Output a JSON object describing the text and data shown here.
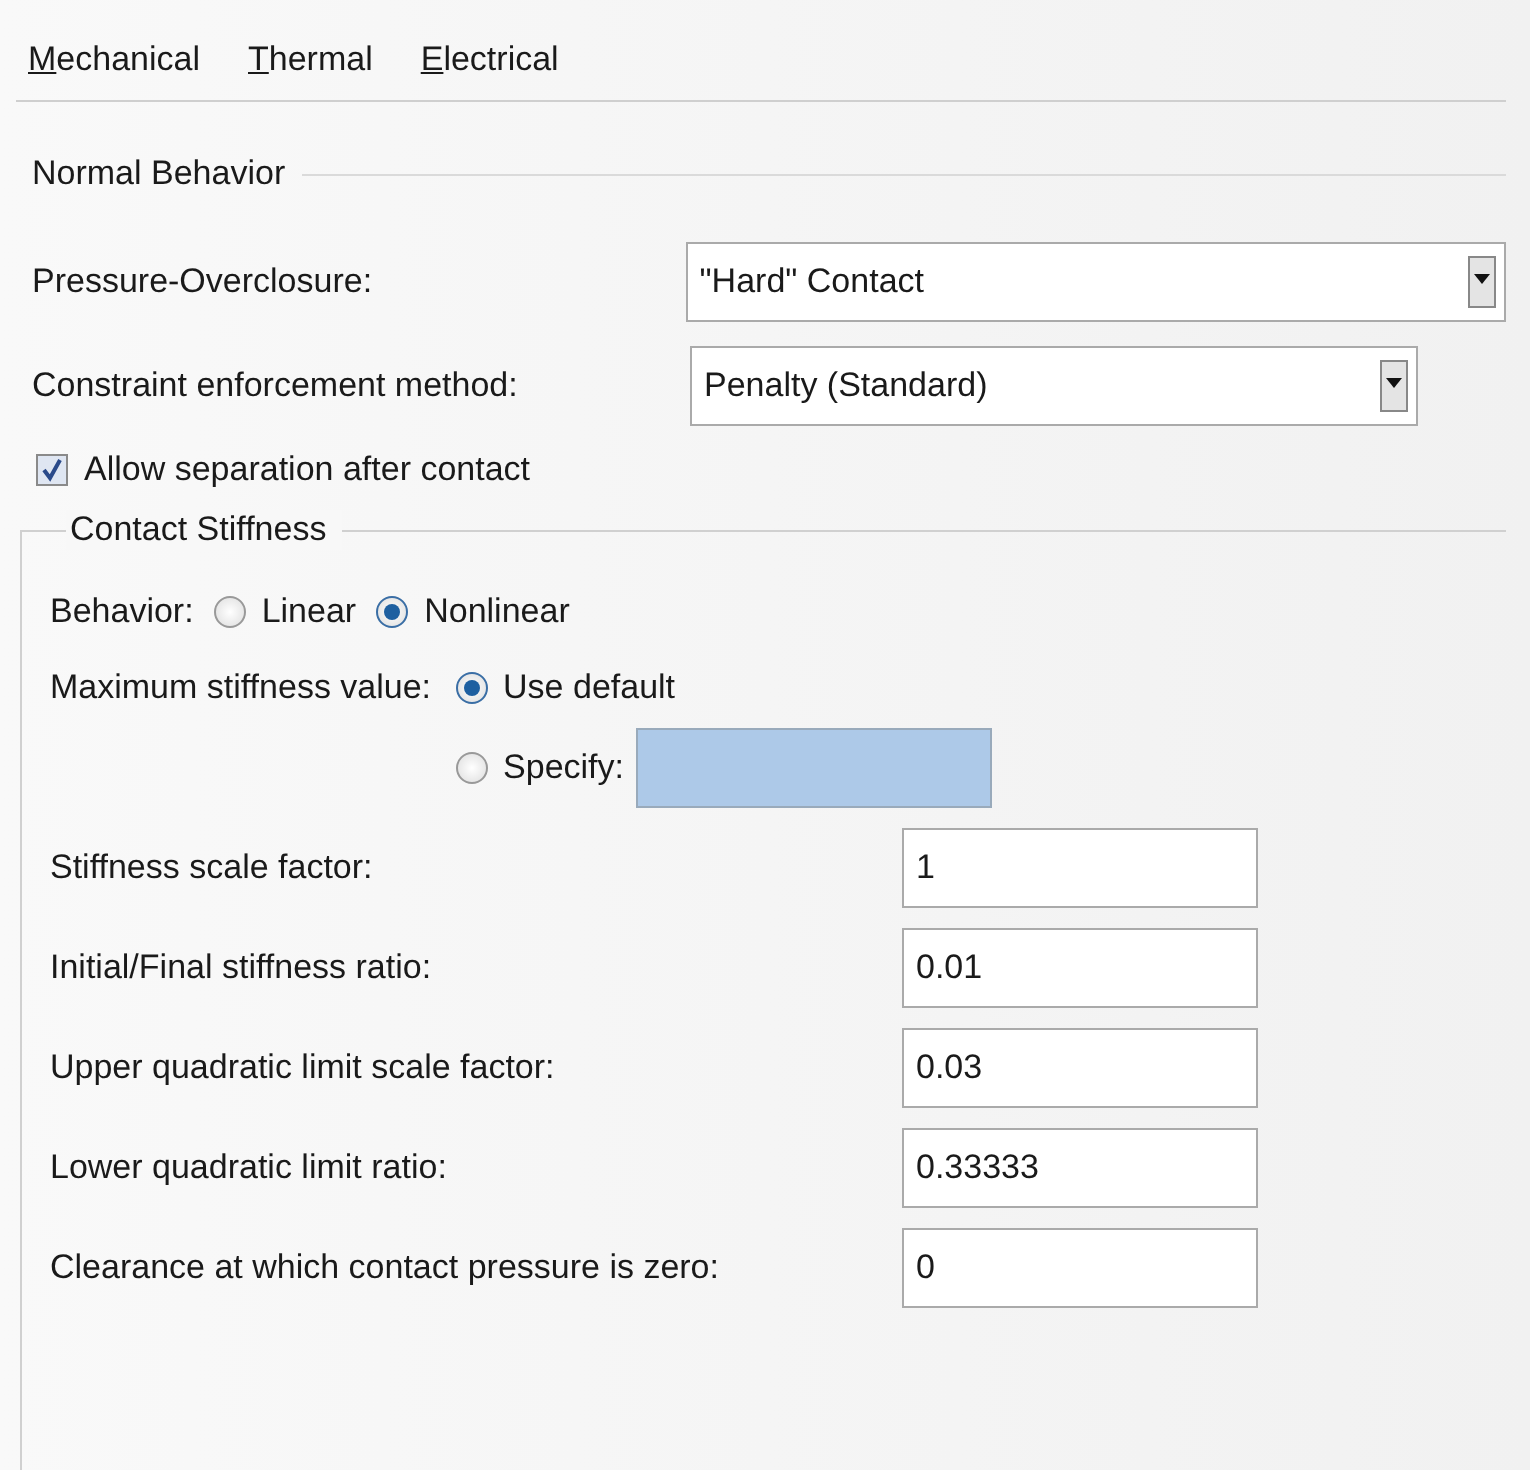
{
  "menu": [
    {
      "label": "Mechanical"
    },
    {
      "label": "Thermal"
    },
    {
      "label": "Electrical"
    }
  ],
  "normal_behavior": {
    "title": "Normal Behavior",
    "dropdowns": [
      {
        "label": "Pressure-Overclosure:",
        "value": "\"Hard\" Contact"
      },
      {
        "label": "Constraint enforcement method:",
        "value": "Penalty (Standard)"
      }
    ],
    "allow_separation": {
      "label": "Allow separation after contact",
      "checked": true
    }
  },
  "contact_stiffness": {
    "title": "Contact Stiffness",
    "behavior": {
      "label": "Behavior:",
      "options": [
        {
          "label": "Linear",
          "selected": false
        },
        {
          "label": "Nonlinear",
          "selected": true
        }
      ]
    },
    "max_stiffness": {
      "label": "Maximum stiffness value:",
      "options": [
        {
          "label": "Use default",
          "selected": true
        },
        {
          "label": "Specify:",
          "selected": false
        }
      ]
    },
    "fields": [
      {
        "label": "Stiffness scale factor:",
        "value": "1"
      },
      {
        "label": "Initial/Final stiffness ratio:",
        "value": "0.01"
      },
      {
        "label": "Upper quadratic limit scale factor:",
        "value": "0.03"
      },
      {
        "label": "Lower quadratic limit ratio:",
        "value": "0.33333"
      },
      {
        "label": "Clearance at which contact pressure is zero:",
        "value": "0"
      }
    ]
  }
}
